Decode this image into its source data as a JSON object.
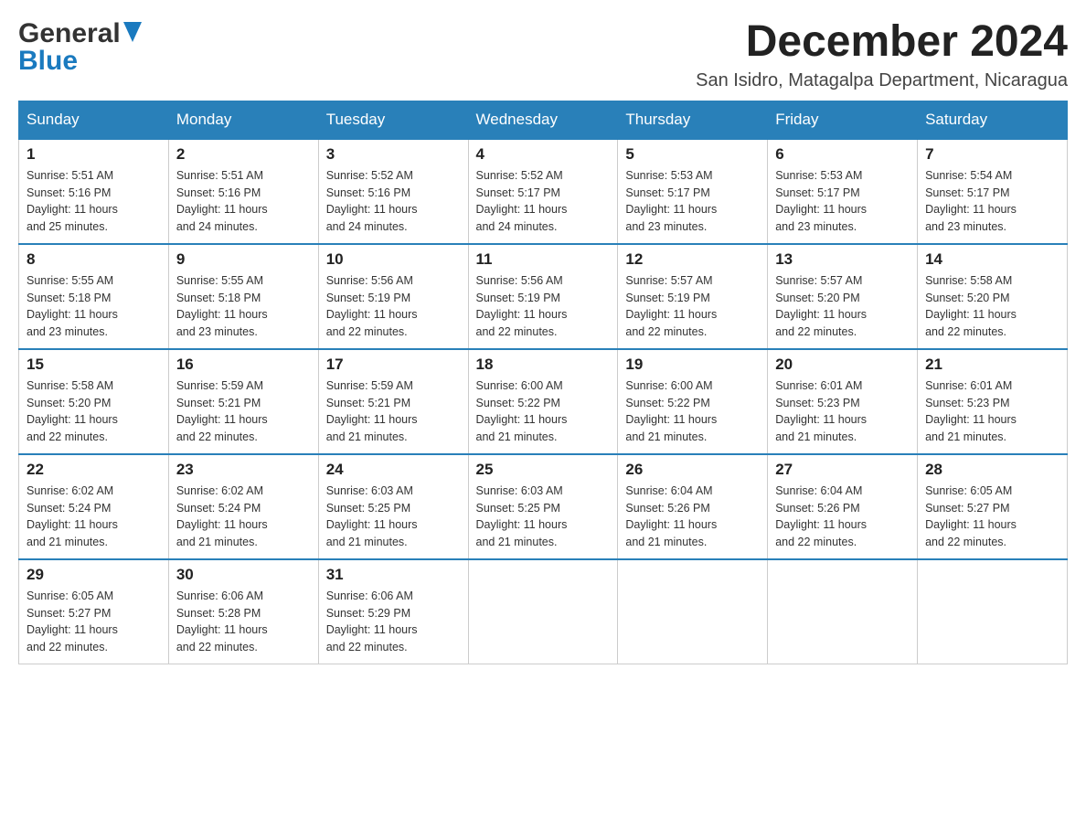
{
  "header": {
    "logo_general": "General",
    "logo_blue": "Blue",
    "month_title": "December 2024",
    "subtitle": "San Isidro, Matagalpa Department, Nicaragua"
  },
  "days_of_week": [
    "Sunday",
    "Monday",
    "Tuesday",
    "Wednesday",
    "Thursday",
    "Friday",
    "Saturday"
  ],
  "weeks": [
    [
      {
        "day": "1",
        "sunrise": "5:51 AM",
        "sunset": "5:16 PM",
        "daylight": "11 hours and 25 minutes."
      },
      {
        "day": "2",
        "sunrise": "5:51 AM",
        "sunset": "5:16 PM",
        "daylight": "11 hours and 24 minutes."
      },
      {
        "day": "3",
        "sunrise": "5:52 AM",
        "sunset": "5:16 PM",
        "daylight": "11 hours and 24 minutes."
      },
      {
        "day": "4",
        "sunrise": "5:52 AM",
        "sunset": "5:17 PM",
        "daylight": "11 hours and 24 minutes."
      },
      {
        "day": "5",
        "sunrise": "5:53 AM",
        "sunset": "5:17 PM",
        "daylight": "11 hours and 23 minutes."
      },
      {
        "day": "6",
        "sunrise": "5:53 AM",
        "sunset": "5:17 PM",
        "daylight": "11 hours and 23 minutes."
      },
      {
        "day": "7",
        "sunrise": "5:54 AM",
        "sunset": "5:17 PM",
        "daylight": "11 hours and 23 minutes."
      }
    ],
    [
      {
        "day": "8",
        "sunrise": "5:55 AM",
        "sunset": "5:18 PM",
        "daylight": "11 hours and 23 minutes."
      },
      {
        "day": "9",
        "sunrise": "5:55 AM",
        "sunset": "5:18 PM",
        "daylight": "11 hours and 23 minutes."
      },
      {
        "day": "10",
        "sunrise": "5:56 AM",
        "sunset": "5:19 PM",
        "daylight": "11 hours and 22 minutes."
      },
      {
        "day": "11",
        "sunrise": "5:56 AM",
        "sunset": "5:19 PM",
        "daylight": "11 hours and 22 minutes."
      },
      {
        "day": "12",
        "sunrise": "5:57 AM",
        "sunset": "5:19 PM",
        "daylight": "11 hours and 22 minutes."
      },
      {
        "day": "13",
        "sunrise": "5:57 AM",
        "sunset": "5:20 PM",
        "daylight": "11 hours and 22 minutes."
      },
      {
        "day": "14",
        "sunrise": "5:58 AM",
        "sunset": "5:20 PM",
        "daylight": "11 hours and 22 minutes."
      }
    ],
    [
      {
        "day": "15",
        "sunrise": "5:58 AM",
        "sunset": "5:20 PM",
        "daylight": "11 hours and 22 minutes."
      },
      {
        "day": "16",
        "sunrise": "5:59 AM",
        "sunset": "5:21 PM",
        "daylight": "11 hours and 22 minutes."
      },
      {
        "day": "17",
        "sunrise": "5:59 AM",
        "sunset": "5:21 PM",
        "daylight": "11 hours and 21 minutes."
      },
      {
        "day": "18",
        "sunrise": "6:00 AM",
        "sunset": "5:22 PM",
        "daylight": "11 hours and 21 minutes."
      },
      {
        "day": "19",
        "sunrise": "6:00 AM",
        "sunset": "5:22 PM",
        "daylight": "11 hours and 21 minutes."
      },
      {
        "day": "20",
        "sunrise": "6:01 AM",
        "sunset": "5:23 PM",
        "daylight": "11 hours and 21 minutes."
      },
      {
        "day": "21",
        "sunrise": "6:01 AM",
        "sunset": "5:23 PM",
        "daylight": "11 hours and 21 minutes."
      }
    ],
    [
      {
        "day": "22",
        "sunrise": "6:02 AM",
        "sunset": "5:24 PM",
        "daylight": "11 hours and 21 minutes."
      },
      {
        "day": "23",
        "sunrise": "6:02 AM",
        "sunset": "5:24 PM",
        "daylight": "11 hours and 21 minutes."
      },
      {
        "day": "24",
        "sunrise": "6:03 AM",
        "sunset": "5:25 PM",
        "daylight": "11 hours and 21 minutes."
      },
      {
        "day": "25",
        "sunrise": "6:03 AM",
        "sunset": "5:25 PM",
        "daylight": "11 hours and 21 minutes."
      },
      {
        "day": "26",
        "sunrise": "6:04 AM",
        "sunset": "5:26 PM",
        "daylight": "11 hours and 21 minutes."
      },
      {
        "day": "27",
        "sunrise": "6:04 AM",
        "sunset": "5:26 PM",
        "daylight": "11 hours and 22 minutes."
      },
      {
        "day": "28",
        "sunrise": "6:05 AM",
        "sunset": "5:27 PM",
        "daylight": "11 hours and 22 minutes."
      }
    ],
    [
      {
        "day": "29",
        "sunrise": "6:05 AM",
        "sunset": "5:27 PM",
        "daylight": "11 hours and 22 minutes."
      },
      {
        "day": "30",
        "sunrise": "6:06 AM",
        "sunset": "5:28 PM",
        "daylight": "11 hours and 22 minutes."
      },
      {
        "day": "31",
        "sunrise": "6:06 AM",
        "sunset": "5:29 PM",
        "daylight": "11 hours and 22 minutes."
      },
      null,
      null,
      null,
      null
    ]
  ],
  "labels": {
    "sunrise": "Sunrise:",
    "sunset": "Sunset:",
    "daylight": "Daylight:"
  }
}
